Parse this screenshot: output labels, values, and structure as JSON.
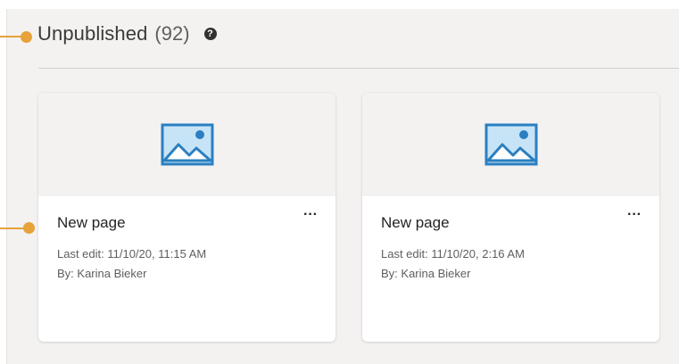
{
  "section": {
    "title": "Unpublished",
    "count": "(92)",
    "help_icon": "question-circle-icon"
  },
  "callouts": {
    "color": "#e8a23a"
  },
  "cards": [
    {
      "title": "New page",
      "more_label": "···",
      "last_edit": "Last edit: 11/10/20, 11:15 AM",
      "author": "By: Karina Bieker",
      "thumbnail_icon": "image-placeholder-icon"
    },
    {
      "title": "New page",
      "more_label": "···",
      "last_edit": "Last edit: 11/10/20, 2:16 AM",
      "author": "By: Karina Bieker",
      "thumbnail_icon": "image-placeholder-icon"
    }
  ],
  "colors": {
    "accent_blue": "#2a7fc1",
    "image_fill": "#c7e4f6",
    "panel_bg": "#f3f2f1"
  }
}
